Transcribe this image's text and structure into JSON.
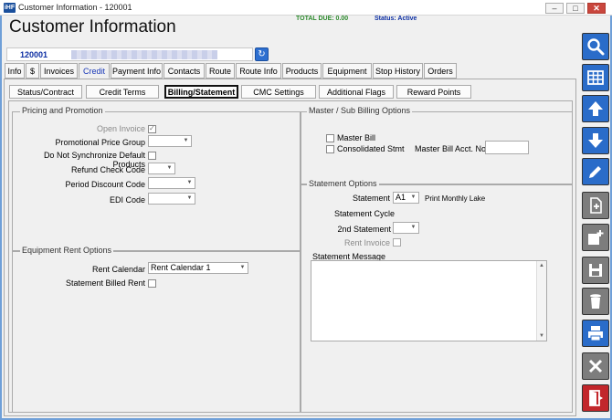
{
  "window": {
    "title": "Customer Information - 120001",
    "app_icon_text": "iHF",
    "minimize_glyph": "–",
    "restore_glyph": "□",
    "close_glyph": "✕"
  },
  "header": {
    "title": "Customer Information",
    "total_due": "TOTAL DUE:  0.00",
    "status": "Status: Active",
    "customer_id": "120001",
    "refresh_glyph": "↻"
  },
  "tabs": [
    {
      "label": "Info"
    },
    {
      "label": "$"
    },
    {
      "label": "Invoices"
    },
    {
      "label": "Credit"
    },
    {
      "label": "Payment Info"
    },
    {
      "label": "Contacts"
    },
    {
      "label": "Route"
    },
    {
      "label": "Route Info"
    },
    {
      "label": "Products"
    },
    {
      "label": "Equipment"
    },
    {
      "label": "Stop History"
    },
    {
      "label": "Orders"
    }
  ],
  "active_tab": "Credit",
  "subtabs": [
    {
      "label": "Status/Contract"
    },
    {
      "label": "Credit Terms"
    },
    {
      "label": "Billing/Statement"
    },
    {
      "label": "CMC Settings"
    },
    {
      "label": "Additional Flags"
    },
    {
      "label": "Reward Points"
    }
  ],
  "active_subtab": "Billing/Statement",
  "pricing": {
    "group_title": "Pricing and Promotion",
    "open_invoice_label": "Open Invoice",
    "open_invoice_checked": true,
    "promo_group_label": "Promotional Price Group",
    "promo_group_value": "",
    "no_sync_label": "Do Not Synchronize Default Products",
    "refund_check_label": "Refund Check Code",
    "refund_check_value": "",
    "period_discount_label": "Period Discount Code",
    "period_discount_value": "",
    "edi_label": "EDI Code",
    "edi_value": ""
  },
  "equipment_rent": {
    "group_title": "Equipment Rent Options",
    "rent_calendar_label": "Rent Calendar",
    "rent_calendar_value": "Rent Calendar 1",
    "statement_billed_rent_label": "Statement Billed Rent"
  },
  "master_sub": {
    "group_title": "Master / Sub Billing Options",
    "master_bill_label": "Master Bill",
    "consolidated_label": "Consolidated Stmt",
    "master_acct_label": "Master Bill Acct. No.",
    "master_acct_value": ""
  },
  "statement": {
    "group_title": "Statement Options",
    "statement_label": "Statement",
    "statement_value": "A1",
    "statement_desc": "Print Monthly Lake",
    "cycle_label": "Statement Cycle",
    "second_label": "2nd Statement",
    "second_value": "",
    "rent_invoice_label": "Rent Invoice",
    "message_label": "Statement Message",
    "message_value": ""
  },
  "sidebar": [
    {
      "name": "search-icon",
      "color": "#2a6cc9"
    },
    {
      "name": "grid-icon",
      "color": "#2a6cc9"
    },
    {
      "name": "arrow-up-icon",
      "color": "#2a6cc9"
    },
    {
      "name": "arrow-down-icon",
      "color": "#2a6cc9"
    },
    {
      "name": "pencil-icon",
      "color": "#2a6cc9"
    },
    {
      "name": "new-document-icon",
      "color": "#7d7d7d"
    },
    {
      "name": "add-record-icon",
      "color": "#7d7d7d"
    },
    {
      "name": "save-icon",
      "color": "#7d7d7d"
    },
    {
      "name": "trash-icon",
      "color": "#7d7d7d"
    },
    {
      "name": "printer-icon",
      "color": "#2a6cc9"
    },
    {
      "name": "cancel-x-icon",
      "color": "#7d7d7d"
    },
    {
      "name": "exit-door-icon",
      "color": "#c2262b"
    }
  ]
}
